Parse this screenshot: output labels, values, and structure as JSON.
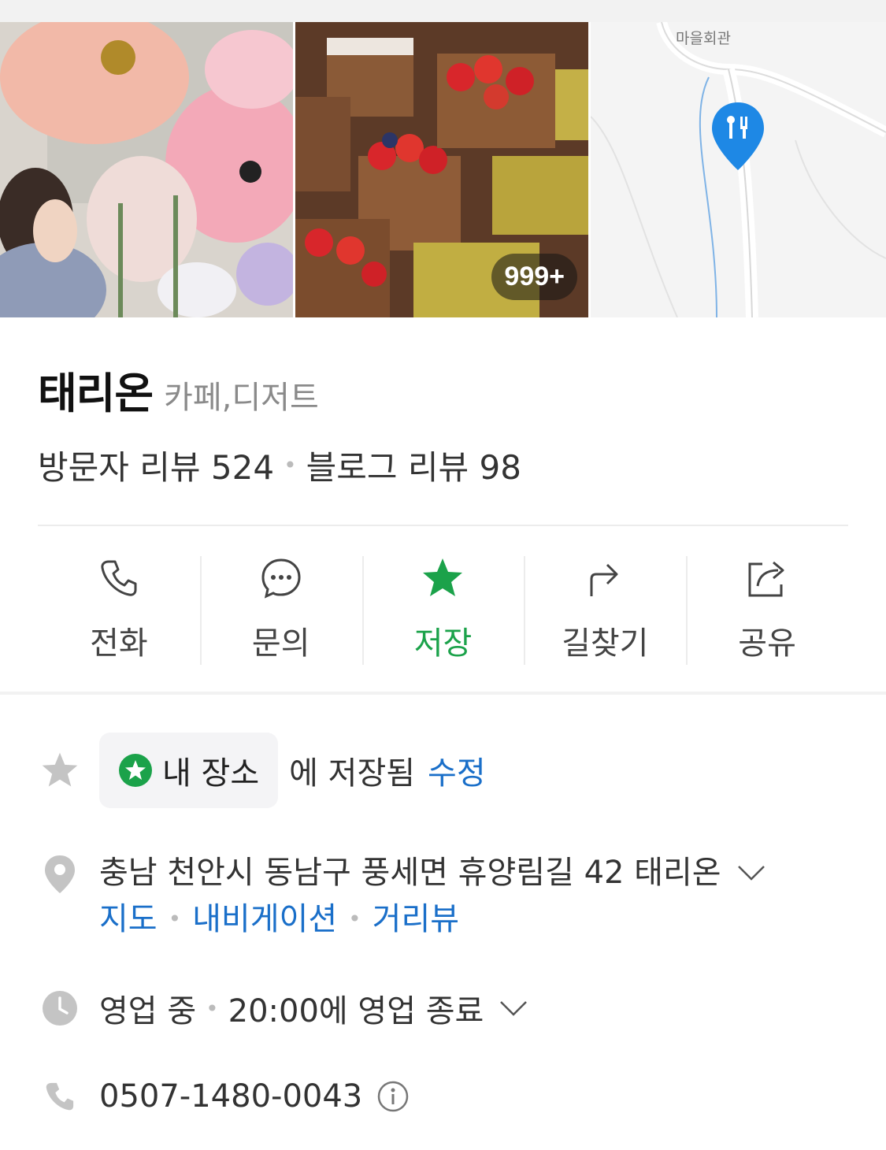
{
  "photos": {
    "count_badge": "999+",
    "map_label": "마을회관"
  },
  "place": {
    "name": "태리온",
    "category": "카페,디저트"
  },
  "reviews": {
    "visitor": "방문자 리뷰 524",
    "blog": "블로그 리뷰 98"
  },
  "actions": [
    {
      "label": "전화",
      "icon": "phone-icon"
    },
    {
      "label": "문의",
      "icon": "chat-icon"
    },
    {
      "label": "저장",
      "icon": "star-icon"
    },
    {
      "label": "길찾기",
      "icon": "directions-icon"
    },
    {
      "label": "공유",
      "icon": "share-icon"
    }
  ],
  "saved": {
    "list_name": "내 장소",
    "suffix": "에 저장됨",
    "edit": "수정"
  },
  "address": {
    "text": "충남 천안시 동남구 풍세면 휴양림길 42 태리온",
    "links": [
      "지도",
      "내비게이션",
      "거리뷰"
    ]
  },
  "hours": {
    "status": "영업 중",
    "detail": "20:00에 영업 종료"
  },
  "phone": {
    "number": "0507-1480-0043"
  },
  "colors": {
    "accent_green": "#1ba24a",
    "link_blue": "#1a6fc9",
    "map_pin": "#1e88e5"
  }
}
